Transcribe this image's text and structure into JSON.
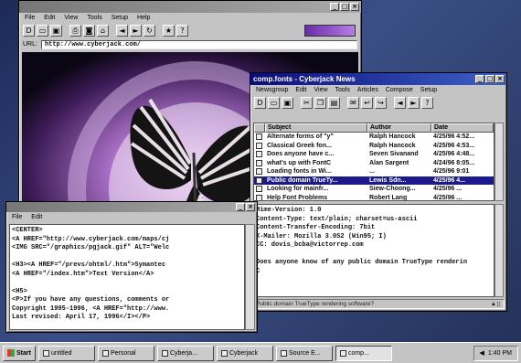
{
  "browser": {
    "menu": [
      "File",
      "Edit",
      "View",
      "Tools",
      "Setup",
      "Help"
    ],
    "url_label": "URL:",
    "url": "http://www.cyberjack.com/"
  },
  "news": {
    "title": "comp.fonts - Cyberjack News",
    "menu": [
      "Newsgroup",
      "Edit",
      "View",
      "Tools",
      "Articles",
      "Compose",
      "Setup"
    ],
    "columns": [
      "Subject",
      "Author",
      "Date"
    ],
    "rows": [
      {
        "subject": "Alternate forms of \"y\"",
        "author": "Ralph Hancock",
        "date": "4/25/96 4:52..."
      },
      {
        "subject": "Classical Greek fon...",
        "author": "Ralph Hancock",
        "date": "4/25/96 4:53..."
      },
      {
        "subject": "Does anyone have c...",
        "author": "Seven Sivanand",
        "date": "4/25/96 4:48..."
      },
      {
        "subject": "what's up with FontC",
        "author": "Alan Sargent",
        "date": "4/24/96 8:05..."
      },
      {
        "subject": "Loading fonts in Wi...",
        "author": "...",
        "date": "4/25/96 9:01"
      },
      {
        "subject": "Public domain TrueTy...",
        "author": "Lewis Sdn...",
        "date": "4/25/96 4..."
      },
      {
        "subject": "Looking for mainfr...",
        "author": "Siew-Choong...",
        "date": "4/25/96 ..."
      },
      {
        "subject": "Help Font Problems",
        "author": "Robert Lang",
        "date": "4/25/96 ..."
      }
    ],
    "body_lines": [
      "Mime-Version: 1.0",
      "Content-Type: text/plain; charset=us-ascii",
      "Content-Transfer-Encoding: 7bit",
      "X-Mailer: Mozilla 3.0S2 (Win95; I)",
      "CC: dovis_bcba@victorrep.com",
      "",
      "Does anyone know of any public domain TrueType renderin",
      "C"
    ],
    "status": "Public domain TrueType rendering software?"
  },
  "editor": {
    "menu": [
      "File",
      "Edit"
    ],
    "lines": [
      "<CENTER>",
      "<A HREF=\"http://www.cyberjack.com/maps/cj",
      "<IMG SRC=\"/graphics/pgjack.gif\" ALT=\"Welc",
      "",
      "<H3><A HREF=\"/prevs/ohtml/.htm\">Symantec",
      "<A HREF=\"/index.htm\">Text Version</A>",
      "",
      "<H5>",
      "<P>If you have any questions, comments or",
      "Copyright 1995-1996, <A HREF=\"http://www.",
      "Last revised: April 17, 1996</I></P>"
    ]
  },
  "taskbar": {
    "start": "Start",
    "tasks": [
      "untitled",
      "Personal",
      "Cyberja...",
      "Cyberjack",
      "Source E...",
      "comp..."
    ],
    "active_index": 5,
    "time": "1:40 PM"
  }
}
